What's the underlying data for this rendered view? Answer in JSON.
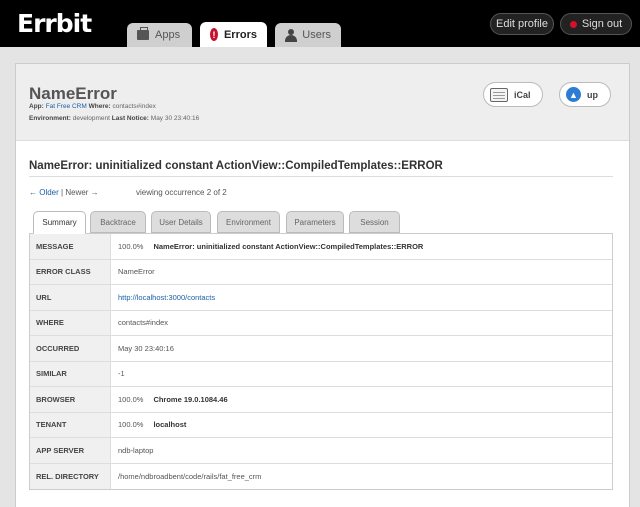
{
  "header": {
    "logo": "Errbit",
    "tabs": [
      {
        "label": "Apps",
        "icon": "briefcase-icon"
      },
      {
        "label": "Errors",
        "icon": "error-icon"
      },
      {
        "label": "Users",
        "icon": "user-icon"
      }
    ],
    "edit_profile": "Edit profile",
    "sign_out": "Sign out"
  },
  "problem": {
    "title": "NameError",
    "app_label": "App:",
    "app_value": "Fat Free CRM",
    "where_label": "Where:",
    "where_value": "contacts#index",
    "env_label": "Environment:",
    "env_value": "development",
    "last_notice_label": "Last Notice:",
    "last_notice_value": "May 30 23:40:16",
    "ical": "iCal",
    "up": "up"
  },
  "message_title": "NameError: uninitialized constant ActionView::CompiledTemplates::ERROR",
  "pager": {
    "older": "← Older",
    "sep": "|",
    "newer": "Newer →",
    "viewing": "viewing occurrence 2 of 2"
  },
  "tabs": [
    "Summary",
    "Backtrace",
    "User Details",
    "Environment",
    "Parameters",
    "Session"
  ],
  "summary": {
    "message": {
      "key": "MESSAGE",
      "pct": "100.0%",
      "value": "NameError: uninitialized constant ActionView::CompiledTemplates::ERROR"
    },
    "error_class": {
      "key": "ERROR CLASS",
      "value": "NameError"
    },
    "url": {
      "key": "URL",
      "value": "http://localhost:3000/contacts"
    },
    "where": {
      "key": "WHERE",
      "value": "contacts#index"
    },
    "occurred": {
      "key": "OCCURRED",
      "value": "May 30 23:40:16"
    },
    "similar": {
      "key": "SIMILAR",
      "value": "-1"
    },
    "browser": {
      "key": "BROWSER",
      "pct": "100.0%",
      "value": "Chrome 19.0.1084.46"
    },
    "tenant": {
      "key": "TENANT",
      "pct": "100.0%",
      "value": "localhost"
    },
    "app_server": {
      "key": "APP SERVER",
      "value": "ndb-laptop"
    },
    "rel_directory": {
      "key": "REL. DIRECTORY",
      "value": "/home/ndbroadbent/code/rails/fat_free_crm"
    }
  }
}
